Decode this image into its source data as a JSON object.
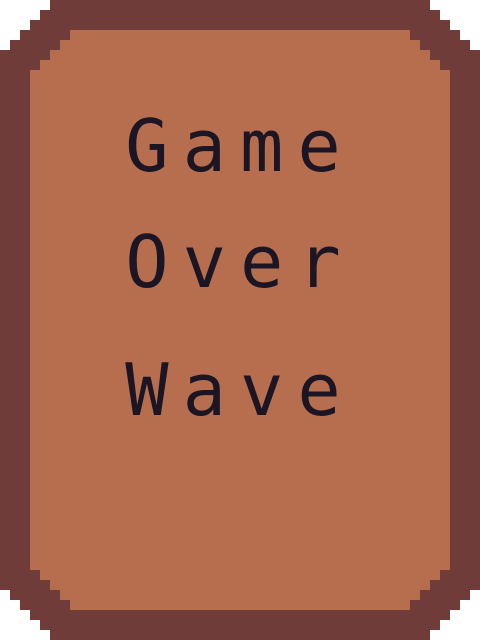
{
  "screen": {
    "lines": [
      "Game",
      "Over",
      "Wave"
    ]
  },
  "colors": {
    "outer_border": "#6f3c39",
    "panel_fill": "#b66e4f",
    "text": "#1b1524",
    "background": "#ffffff"
  }
}
